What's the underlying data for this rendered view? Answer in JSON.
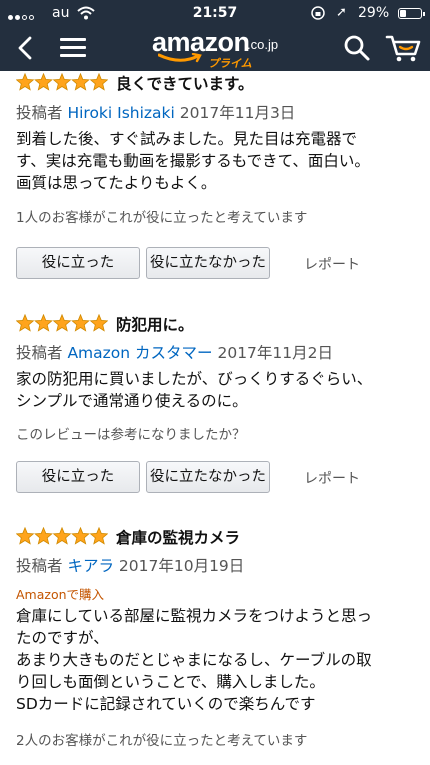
{
  "status_bar": {
    "carrier": "au",
    "time": "21:57",
    "battery": "29%",
    "battery_level": 0.29
  },
  "header": {
    "logo_text": "amazon",
    "logo_tld": ".co.jp",
    "logo_sub": "プライム"
  },
  "reviews": [
    {
      "rating": 5,
      "title": "良くできています。",
      "byline_prefix": "投稿者",
      "author": "Hiroki Ishizaki",
      "date": "2017年11月3日",
      "body": [
        "到着した後、すぐ試みました。見た目は充電器で",
        "す、実は充電も動画を撮影するもできて、面白い。",
        "画質は思ってたよりもよく。"
      ],
      "helpful": "1人のお客様がこれが役に立ったと考えています",
      "helpful_button": "役に立った",
      "unhelpful_button": "役に立たなかった",
      "report": "レポート"
    },
    {
      "rating": 5,
      "title": "防犯用に。",
      "byline_prefix": "投稿者",
      "author": "Amazon カスタマー",
      "date": "2017年11月2日",
      "body": [
        "家の防犯用に買いましたが、びっくりするぐらい、",
        "シンプルで通常通り使えるのに。"
      ],
      "helpful": "このレビューは参考になりましたか？",
      "helpful_button": "役に立った",
      "unhelpful_button": "役に立たなかった",
      "report": "レポート"
    },
    {
      "rating": 5,
      "title": "倉庫の監視カメラ",
      "byline_prefix": "投稿者",
      "author": "キアラ",
      "date": "2017年10月19日",
      "badge": "Amazonで購入",
      "body": [
        "倉庫にしている部屋に監視カメラをつけようと思っ",
        "たのですが、",
        "あまり大きものだとじゃまになるし、ケーブルの取",
        "り回しも面倒ということで、購入しました。",
        "SDカードに記録されていくので楽ちんです"
      ],
      "helpful": "2人のお客様がこれが役に立ったと考えています"
    }
  ],
  "colors": {
    "header_bg": "#232f3e",
    "star": "#ffa41c",
    "link": "#0066c0",
    "badge": "#c45500"
  },
  "icons": [
    "back-chevron-icon",
    "menu-icon",
    "search-icon",
    "cart-icon",
    "star-icon",
    "wifi-icon",
    "lock-rotation-icon",
    "location-icon",
    "battery-icon"
  ]
}
